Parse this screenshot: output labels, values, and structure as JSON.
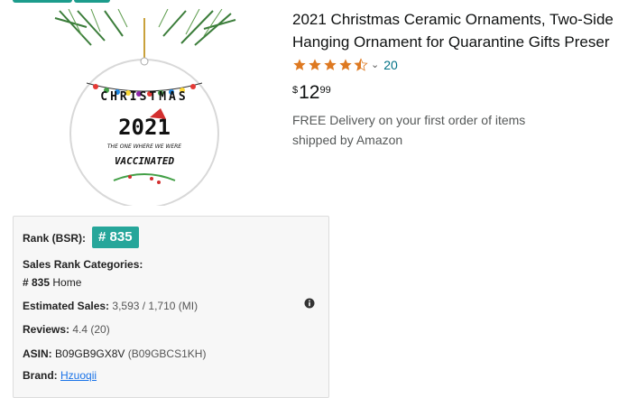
{
  "product": {
    "title_line1": "2021 Christmas Ceramic Ornaments, Two-Side",
    "title_line2": "Hanging Ornament for Quarantine Gifts Preser",
    "rating": 4.5,
    "review_count": "20",
    "price_symbol": "$",
    "price_whole": "12",
    "price_fraction": "99",
    "delivery_line1": "FREE Delivery on your first order of items",
    "delivery_line2": "shipped by Amazon"
  },
  "image": {
    "text_christmas": "CHRISTMAS",
    "text_year": "2021",
    "text_tagline": "THE ONE WHERE WE WERE",
    "text_vaccinated": "VACCINATED"
  },
  "panel": {
    "rank_label": "Rank (BSR):",
    "rank_value": "# 835",
    "categories_label": "Sales Rank Categories:",
    "category_rank": "# 835",
    "category_name": "Home",
    "est_sales_label": "Estimated Sales:",
    "est_sales_value": "3,593 / 1,710 (MI)",
    "reviews_label": "Reviews:",
    "reviews_value": "4.4 (20)",
    "asin_label": "ASIN:",
    "asin_value": "B09GB9GX8V",
    "asin_alt": "(B09GBCS1KH)",
    "brand_label": "Brand:",
    "brand_value": "Hzuoqii"
  },
  "colors": {
    "badge": "#26a69a",
    "star": "#de7921",
    "link": "#007185"
  }
}
